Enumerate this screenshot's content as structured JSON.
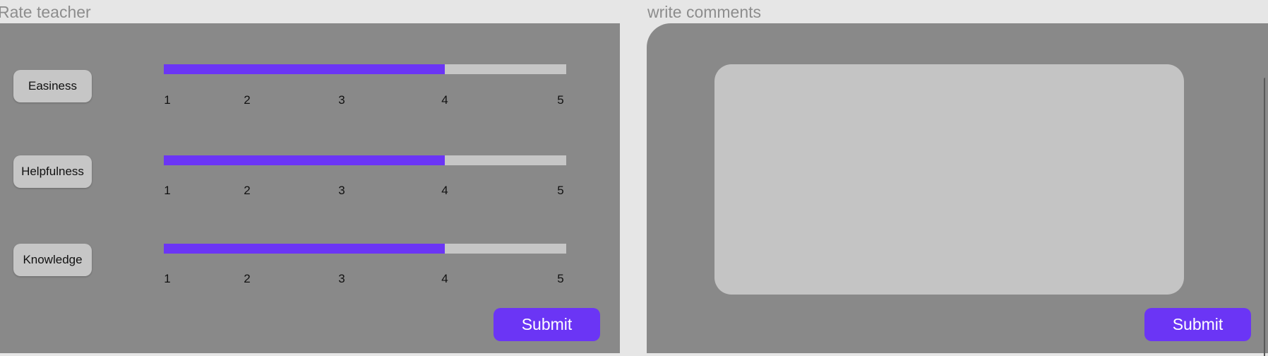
{
  "rate_section": {
    "title": "Rate teacher",
    "criteria": [
      {
        "label": "Easiness",
        "rating": 4
      },
      {
        "label": "Helpfulness",
        "rating": 4
      },
      {
        "label": "Knowledge",
        "rating": 4
      }
    ],
    "scale": [
      "1",
      "2",
      "3",
      "4",
      "5"
    ],
    "submit_label": "Submit"
  },
  "comments_section": {
    "title": "write comments",
    "comment_value": "",
    "submit_label": "Submit"
  },
  "colors": {
    "accent": "#6b35f5",
    "panel": "#898989",
    "track": "#c6c6c6",
    "background": "#e6e6e6"
  }
}
